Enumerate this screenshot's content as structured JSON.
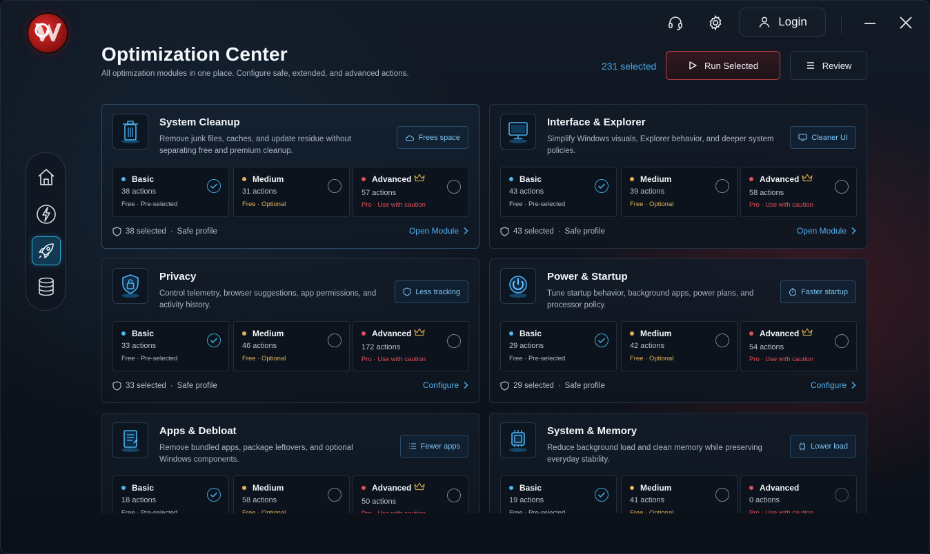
{
  "header": {
    "title": "Optimization Center",
    "subtitle": "All optimization modules in one place. Configure safe, extended, and advanced actions.",
    "selected_count": "231 selected",
    "run_label": "Run Selected",
    "review_label": "Review"
  },
  "topbar": {
    "login_label": "Login"
  },
  "sidebar": {
    "items": [
      {
        "name": "home",
        "icon": "home-icon"
      },
      {
        "name": "boost",
        "icon": "lightning-icon"
      },
      {
        "name": "optimize",
        "icon": "rocket-icon",
        "active": true
      },
      {
        "name": "storage",
        "icon": "database-icon"
      }
    ]
  },
  "colors": {
    "accent": "#3aa7e0",
    "basic": "#4fb6ee",
    "medium": "#e3b15a",
    "advanced": "#e0505a",
    "danger_border": "#b84040"
  },
  "tiers_common": {
    "basic": {
      "name": "Basic",
      "note": "Free · Pre-selected"
    },
    "medium": {
      "name": "Medium",
      "note": "Free · Optional"
    },
    "advanced": {
      "name": "Advanced",
      "note": "Pro · Use with caution"
    }
  },
  "modules": [
    {
      "title": "System Cleanup",
      "desc": "Remove junk files, caches, and update residue without separating free and premium cleanup.",
      "tag": "Frees space",
      "basic_count": "38 actions",
      "medium_count": "31 actions",
      "advanced_count": "57 actions",
      "selected": "38 selected",
      "profile": "Safe profile",
      "link": "Open Module"
    },
    {
      "title": "Interface & Explorer",
      "desc": "Simplify Windows visuals, Explorer behavior, and deeper system policies.",
      "tag": "Cleaner UI",
      "basic_count": "43 actions",
      "medium_count": "39 actions",
      "advanced_count": "58 actions",
      "selected": "43 selected",
      "profile": "Safe profile",
      "link": "Open Module"
    },
    {
      "title": "Privacy",
      "desc": "Control telemetry, browser suggestions, app permissions, and activity history.",
      "tag": "Less tracking",
      "basic_count": "33 actions",
      "medium_count": "46 actions",
      "advanced_count": "172 actions",
      "selected": "33 selected",
      "profile": "Safe profile",
      "link": "Configure"
    },
    {
      "title": "Power & Startup",
      "desc": "Tune startup behavior, background apps, power plans, and processor policy.",
      "tag": "Faster startup",
      "basic_count": "29 actions",
      "medium_count": "42 actions",
      "advanced_count": "54 actions",
      "selected": "29 selected",
      "profile": "Safe profile",
      "link": "Configure"
    },
    {
      "title": "Apps & Debloat",
      "desc": "Remove bundled apps, package leftovers, and optional Windows components.",
      "tag": "Fewer apps",
      "basic_count": "18 actions",
      "medium_count": "58 actions",
      "advanced_count": "50 actions"
    },
    {
      "title": "System & Memory",
      "desc": "Reduce background load and clean memory while preserving everyday stability.",
      "tag": "Lower load",
      "basic_count": "19 actions",
      "medium_count": "41 actions",
      "advanced_count": "0 actions"
    }
  ]
}
